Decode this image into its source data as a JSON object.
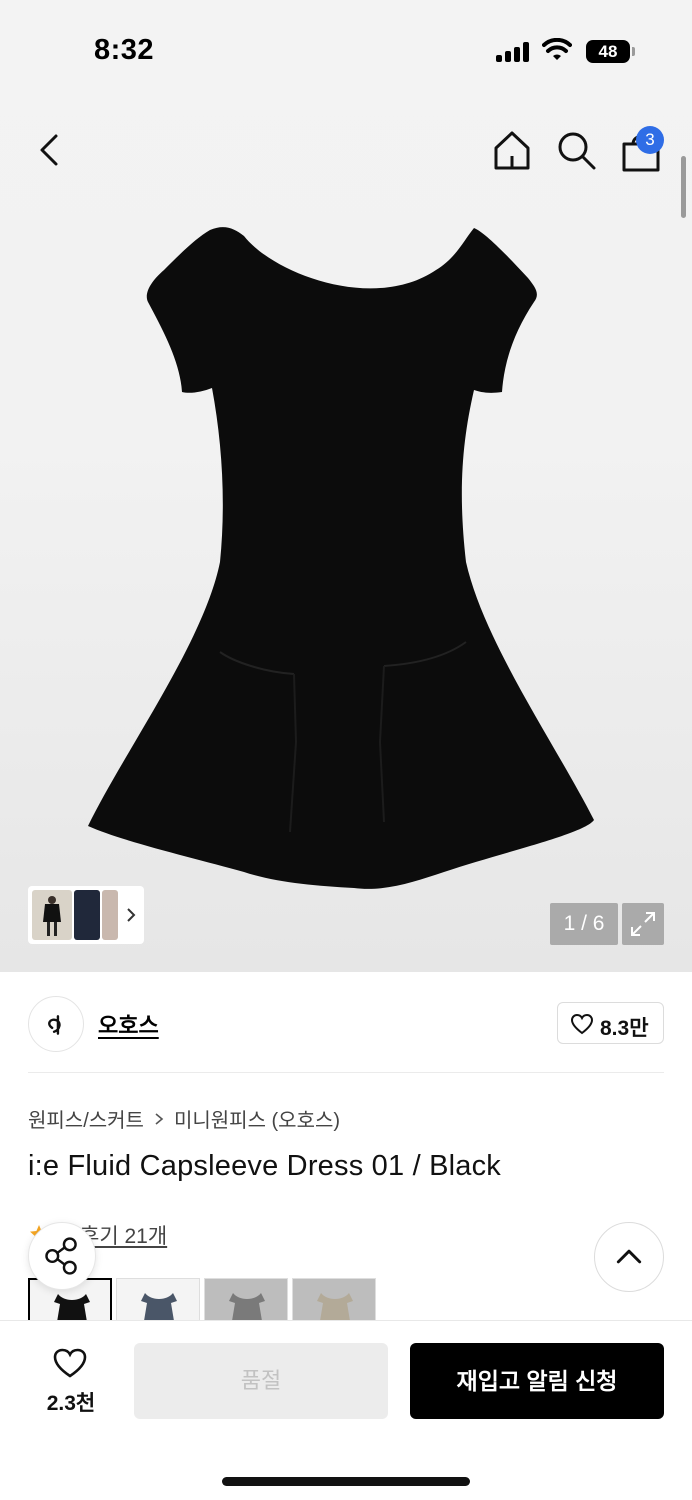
{
  "status_bar": {
    "time": "8:32",
    "battery": "48"
  },
  "nav": {
    "cart_count": "3"
  },
  "gallery": {
    "counter": "1 / 6"
  },
  "brand": {
    "name": "오호스",
    "likes": "8.3만"
  },
  "breadcrumb": [
    "원피스/스커트",
    "미니원피스 (오호스)"
  ],
  "product": {
    "title": "i:e Fluid Capsleeve Dress 01 / Black",
    "review_label": "후기 21개"
  },
  "colors": {
    "accent": "#2f6de6",
    "star": "#f5a623",
    "swatches": [
      "Black",
      "Navy",
      "Gray",
      "Beige"
    ]
  },
  "bottom_bar": {
    "wish_count": "2.3천",
    "sold_out_label": "품절",
    "restock_label": "재입고 알림 신청"
  }
}
